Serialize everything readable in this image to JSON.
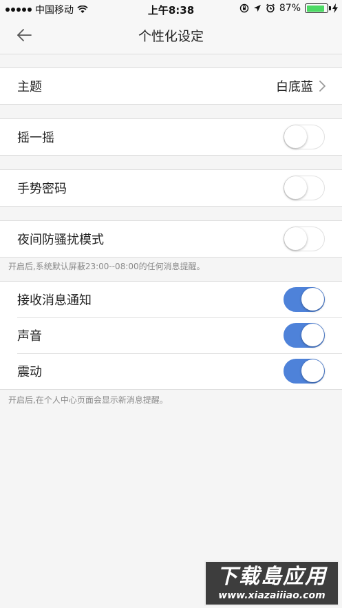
{
  "status_bar": {
    "carrier": "中国移动",
    "time": "上午8:38",
    "battery_percent": "87%",
    "battery_level": 0.87
  },
  "nav": {
    "title": "个性化设定",
    "back_icon": "arrow-left-icon"
  },
  "groups": {
    "theme": {
      "label": "主题",
      "value": "白底蓝"
    },
    "shake": {
      "label": "摇一摇",
      "on": false
    },
    "gesture": {
      "label": "手势密码",
      "on": false
    },
    "night": {
      "label": "夜间防骚扰模式",
      "on": false
    }
  },
  "notes": {
    "night": "开启后,系统默认屏蔽23:00--08:00的任何消息提醒。",
    "notify": "开启后,在个人中心页面会显示新消息提醒。"
  },
  "notifications": {
    "receive": {
      "label": "接收消息通知",
      "on": true
    },
    "sound": {
      "label": "声音",
      "on": true
    },
    "vibrate": {
      "label": "震动",
      "on": true
    }
  },
  "watermark": {
    "title": "下载島应用",
    "url": "www.xiazaiiiao.com"
  },
  "colors": {
    "accent": "#4e82d9",
    "toggle_off_border": "#e0e0e0",
    "background": "#f5f5f5"
  }
}
